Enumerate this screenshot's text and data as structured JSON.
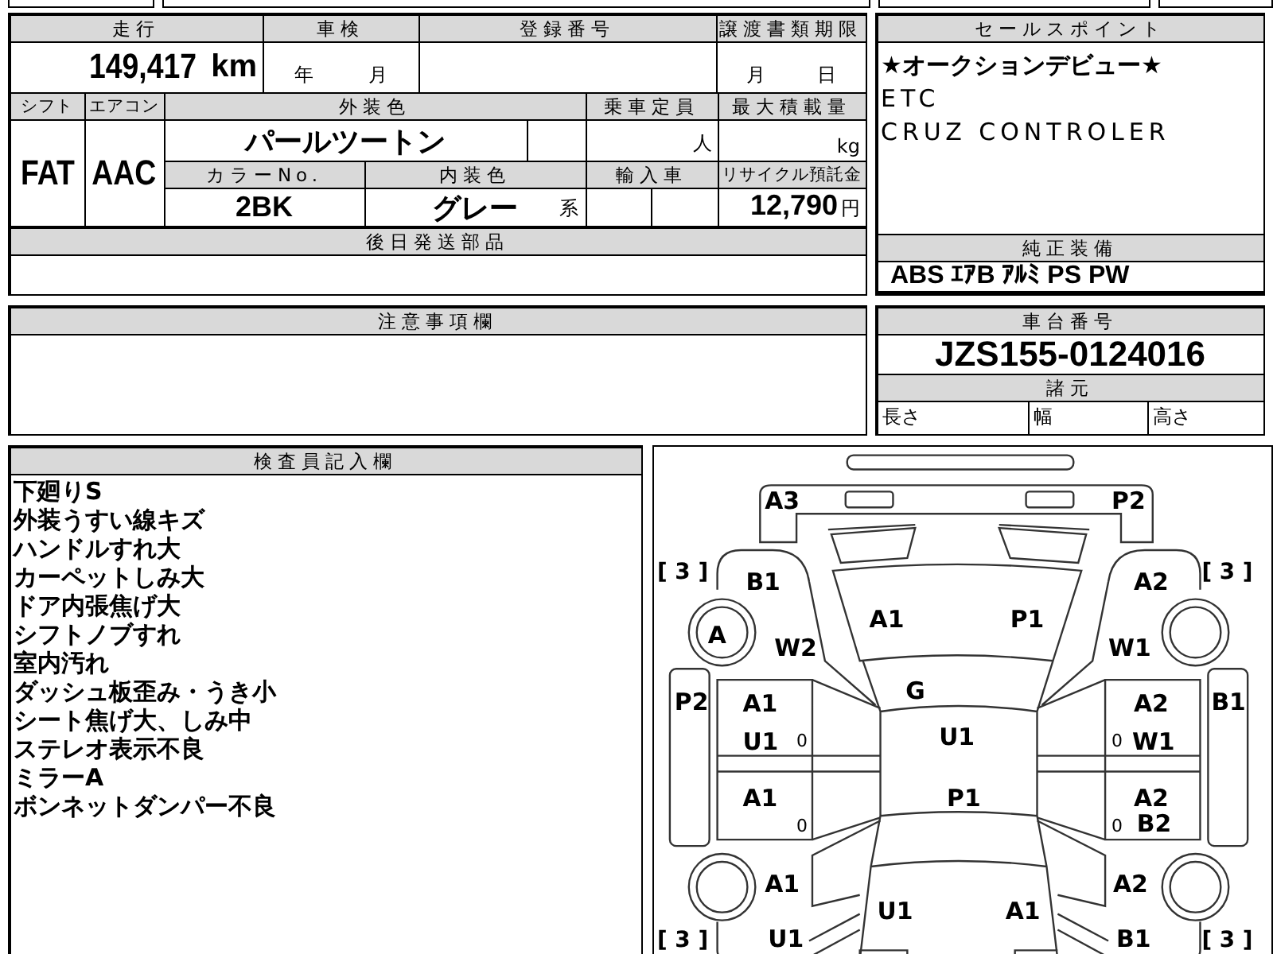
{
  "top_table": {
    "odometer": {
      "label": "走行",
      "value": "149,417",
      "unit": "km"
    },
    "inspection": {
      "label": "車検",
      "year_unit": "年",
      "month_unit": "月"
    },
    "registration": {
      "label": "登録番号"
    },
    "transfer_deadline": {
      "label": "譲渡書類期限",
      "month_unit": "月",
      "day_unit": "日"
    },
    "shift": {
      "label": "シフト",
      "value": "FAT"
    },
    "aircon": {
      "label": "エアコン",
      "value": "AAC"
    },
    "exterior_color": {
      "label": "外装色",
      "value": "パールツートン"
    },
    "capacity": {
      "label": "乗車定員",
      "unit": "人"
    },
    "max_load": {
      "label": "最大積載量",
      "unit": "kg"
    },
    "color_no": {
      "label": "カラーNo.",
      "value": "2BK"
    },
    "interior_color": {
      "label": "内装色",
      "value": "グレー",
      "suffix": "系"
    },
    "import": {
      "label": "輸入車"
    },
    "recycle_fee": {
      "label": "リサイクル預託金",
      "value": "12,790",
      "unit": "円"
    },
    "later_parts": {
      "label": "後日発送部品"
    }
  },
  "sale_points": {
    "label": "セールスポイント",
    "lines": [
      "★オークションデビュー★",
      "ETC",
      "CRUZ CONTROLER"
    ]
  },
  "standard_equipment": {
    "label": "純正装備",
    "value": "ABS ｴｱB ｱﾙﾐ PS PW"
  },
  "notes": {
    "label": "注意事項欄"
  },
  "chassis": {
    "label": "車台番号",
    "value": "JZS155-0124016",
    "specs_label": "諸元",
    "spec_fields": [
      "長さ",
      "幅",
      "高さ"
    ]
  },
  "inspector": {
    "label": "検査員記入欄",
    "lines": [
      "下廻りS",
      "外装うすい線キズ",
      "ハンドルすれ大",
      "カーペットしみ大",
      "ドア内張焦げ大",
      "シフトノブすれ",
      "室内汚れ",
      "ダッシュ板歪み・うき小",
      "シート焦げ大、しみ中",
      "ステレオ表示不良",
      "ミラーA",
      "ボンネットダンパー不良"
    ]
  },
  "diagram": {
    "marks": [
      {
        "kind": "code",
        "text": "A3"
      },
      {
        "kind": "code",
        "text": "P2"
      },
      {
        "kind": "bracket",
        "text": "[ 3 ]"
      },
      {
        "kind": "code",
        "text": "B1"
      },
      {
        "kind": "code",
        "text": "A2"
      },
      {
        "kind": "bracket",
        "text": "[ 3 ]"
      },
      {
        "kind": "code",
        "text": "A1"
      },
      {
        "kind": "code",
        "text": "P1"
      },
      {
        "kind": "code",
        "text": "A"
      },
      {
        "kind": "code",
        "text": "W2"
      },
      {
        "kind": "code",
        "text": "W1"
      },
      {
        "kind": "code",
        "text": "G"
      },
      {
        "kind": "code",
        "text": "P2"
      },
      {
        "kind": "code",
        "text": "A1"
      },
      {
        "kind": "code",
        "text": "A2"
      },
      {
        "kind": "code",
        "text": "B1"
      },
      {
        "kind": "code",
        "text": "U1"
      },
      {
        "kind": "small",
        "text": "0"
      },
      {
        "kind": "code",
        "text": "U1"
      },
      {
        "kind": "small",
        "text": "0"
      },
      {
        "kind": "code",
        "text": "W1"
      },
      {
        "kind": "code",
        "text": "A1"
      },
      {
        "kind": "code",
        "text": "P1"
      },
      {
        "kind": "code",
        "text": "A2"
      },
      {
        "kind": "small",
        "text": "0"
      },
      {
        "kind": "small",
        "text": "0"
      },
      {
        "kind": "code",
        "text": "B2"
      },
      {
        "kind": "code",
        "text": "A1"
      },
      {
        "kind": "code",
        "text": "A2"
      },
      {
        "kind": "code",
        "text": "U1"
      },
      {
        "kind": "code",
        "text": "A1"
      },
      {
        "kind": "bracket",
        "text": "[ 3 ]"
      },
      {
        "kind": "code",
        "text": "U1"
      },
      {
        "kind": "code",
        "text": "B1"
      },
      {
        "kind": "bracket",
        "text": "[ 3 ]"
      }
    ]
  }
}
